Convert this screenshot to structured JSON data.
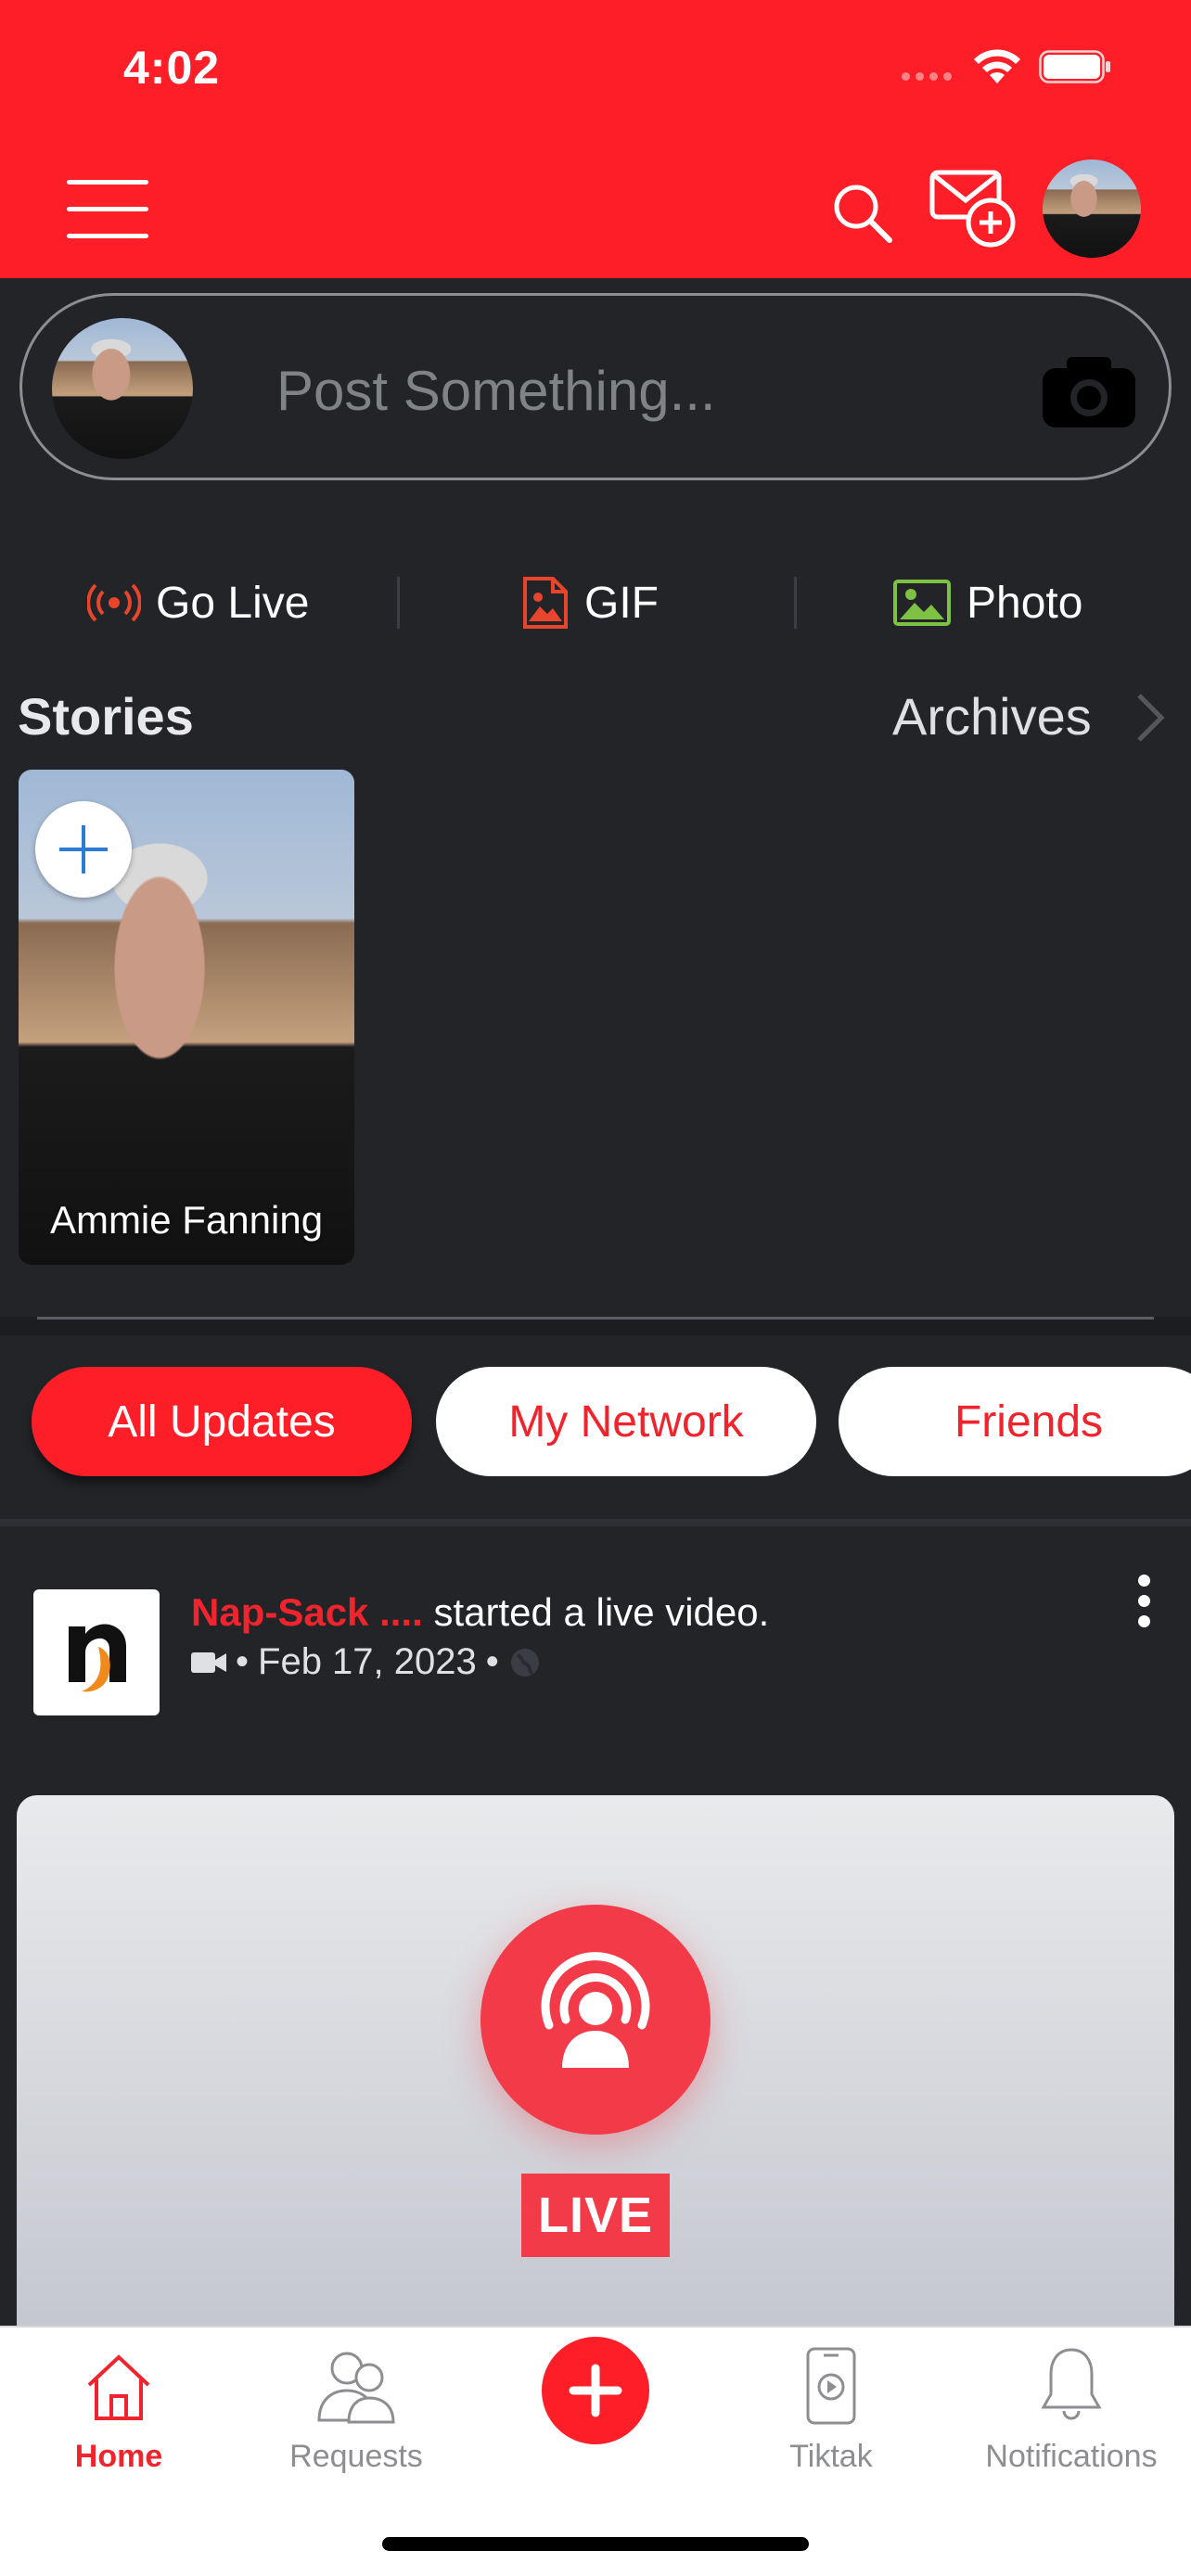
{
  "status_bar": {
    "time": "4:02"
  },
  "header": {
    "menu_icon": "hamburger-icon",
    "search_icon": "search-icon",
    "compose_icon": "mail-plus-icon"
  },
  "composer": {
    "placeholder": "Post Something..."
  },
  "quick_actions": [
    {
      "label": "Go Live",
      "icon": "broadcast-icon",
      "color": "#e8452c"
    },
    {
      "label": "GIF",
      "icon": "gif-image-icon",
      "color": "#e8452c"
    },
    {
      "label": "Photo",
      "icon": "photo-icon",
      "color": "#7dc242"
    }
  ],
  "stories": {
    "title": "Stories",
    "archives_label": "Archives",
    "items": [
      {
        "name": "Ammie Fanning"
      }
    ]
  },
  "filter_tabs": [
    {
      "label": "All Updates",
      "active": true
    },
    {
      "label": "My Network",
      "active": false
    },
    {
      "label": "Friends",
      "active": false
    }
  ],
  "post": {
    "author": "Nap-Sack ....",
    "action": "started a live video.",
    "date": "Feb 17, 2023",
    "separator": "•",
    "live_label": "LIVE"
  },
  "bottom_nav": [
    {
      "label": "Home",
      "icon": "home-icon",
      "active": true
    },
    {
      "label": "Requests",
      "icon": "users-icon",
      "active": false
    },
    {
      "label": "",
      "icon": "plus-icon",
      "active": false
    },
    {
      "label": "Tiktak",
      "icon": "phone-play-icon",
      "active": false
    },
    {
      "label": "Notifications",
      "icon": "bell-icon",
      "active": false
    }
  ],
  "colors": {
    "brand_red": "#fe1e27",
    "background": "#232428",
    "live_red": "#f33a48"
  }
}
